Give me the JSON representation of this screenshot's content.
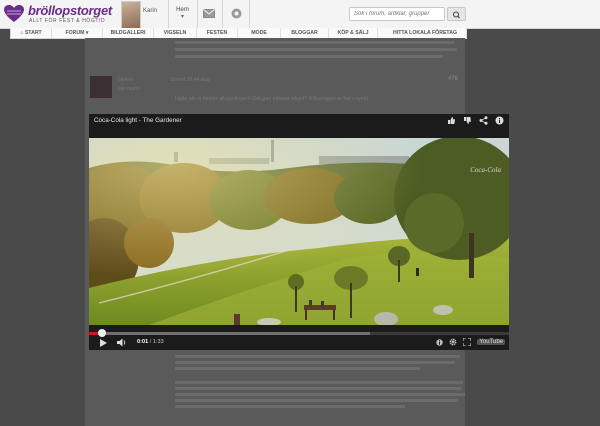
{
  "header": {
    "brand": "bröllopstorget",
    "tagline": "ALLT FÖR FEST & HÖGTID",
    "user_name": "Karin",
    "home_label": "Hem",
    "home_caret": "▾",
    "search_placeholder": "Sök i forum, artiklar, grupper"
  },
  "nav": {
    "items": [
      {
        "label": "⌂ START"
      },
      {
        "label": "FORUM ▾"
      },
      {
        "label": "BILDGALLERI"
      },
      {
        "label": "VIGSELN"
      },
      {
        "label": "FESTEN"
      },
      {
        "label": "MODE"
      },
      {
        "label": "BLOGGAR"
      },
      {
        "label": "KÖP & SÄLJ"
      },
      {
        "label": "HITTA LOKALA FÖRETAG"
      }
    ]
  },
  "post": {
    "username": "Glyfers",
    "role": "Vän mobb",
    "meta": "Skrivet 10:44 idag",
    "number": "#78",
    "text": "Hjälp att rå hinner alt pyvlinger!! Ost gari mitarar någet? Klåcningen er het i nyekt."
  },
  "player": {
    "title": "Coca-Cola light - The Gardener",
    "watermark": "Coca-Cola",
    "time_current": "0:01",
    "time_total": "1:33",
    "progress_played": 0.03,
    "progress_loaded": 0.67,
    "youtube_label": "YouTube"
  },
  "colors": {
    "brand": "#6a2c8a",
    "progress_red": "#cc181e"
  }
}
